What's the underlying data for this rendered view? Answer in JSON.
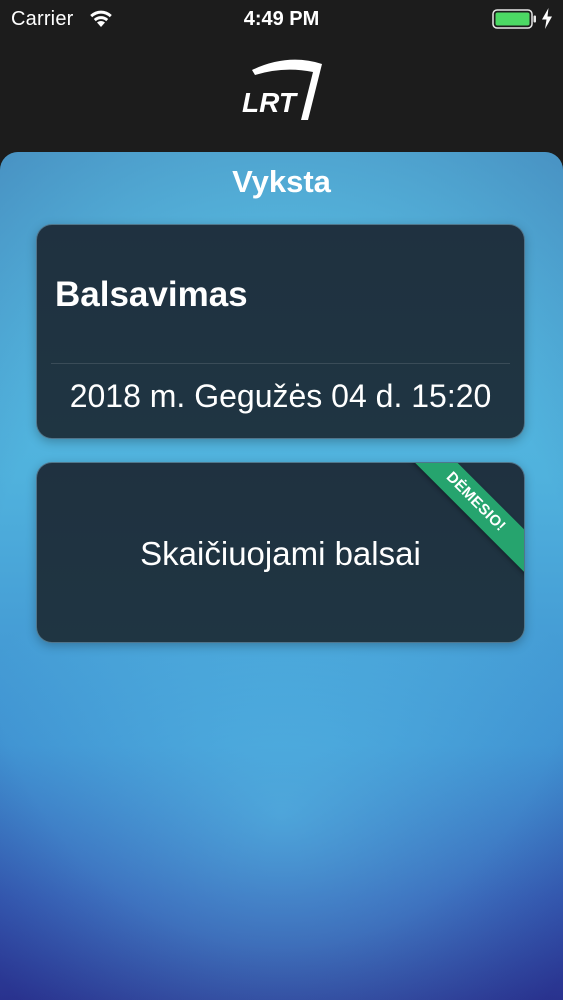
{
  "status_bar": {
    "carrier": "Carrier",
    "time": "4:49 PM",
    "battery_color": "#4cd964"
  },
  "header": {
    "logo_text": "LRT"
  },
  "main": {
    "title": "Vyksta",
    "cards": [
      {
        "heading": "Balsavimas",
        "date": "2018 m. Gegužės 04 d. 15:20"
      },
      {
        "status": "Skaičiuojami balsai",
        "ribbon": "DĖMESIO!",
        "ribbon_color": "#26a46e"
      }
    ]
  }
}
